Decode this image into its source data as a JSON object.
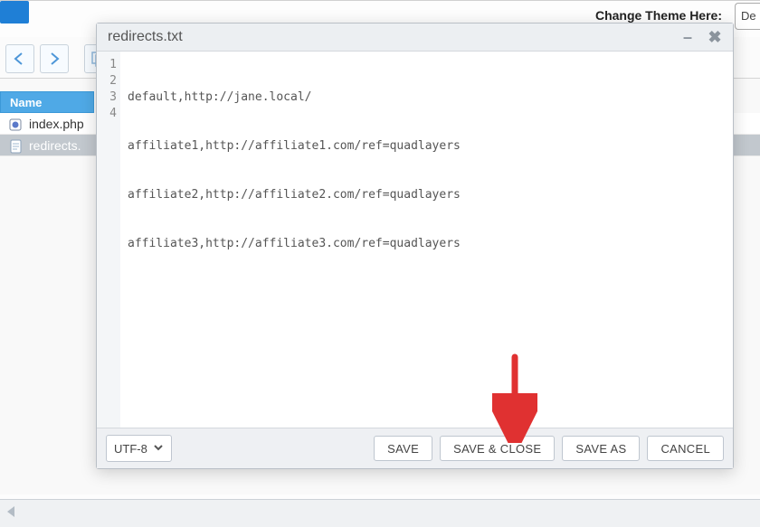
{
  "header": {
    "theme_label": "Change Theme Here:",
    "theme_button_label": "De"
  },
  "file_panel": {
    "column_header": "Name",
    "rows": [
      {
        "name": "index.php",
        "selected": false
      },
      {
        "name": "redirects.",
        "selected": true
      }
    ]
  },
  "editor_dialog": {
    "title": "redirects.txt",
    "lines": [
      "default,http://jane.local/",
      "affiliate1,http://affiliate1.com/ref=quadlayers",
      "affiliate2,http://affiliate2.com/ref=quadlayers",
      "affiliate3,http://affiliate3.com/ref=quadlayers"
    ],
    "line_numbers": [
      "1",
      "2",
      "3",
      "4"
    ],
    "encoding": "UTF-8",
    "buttons": {
      "save": "SAVE",
      "save_close": "SAVE & CLOSE",
      "save_as": "SAVE AS",
      "cancel": "CANCEL"
    }
  }
}
